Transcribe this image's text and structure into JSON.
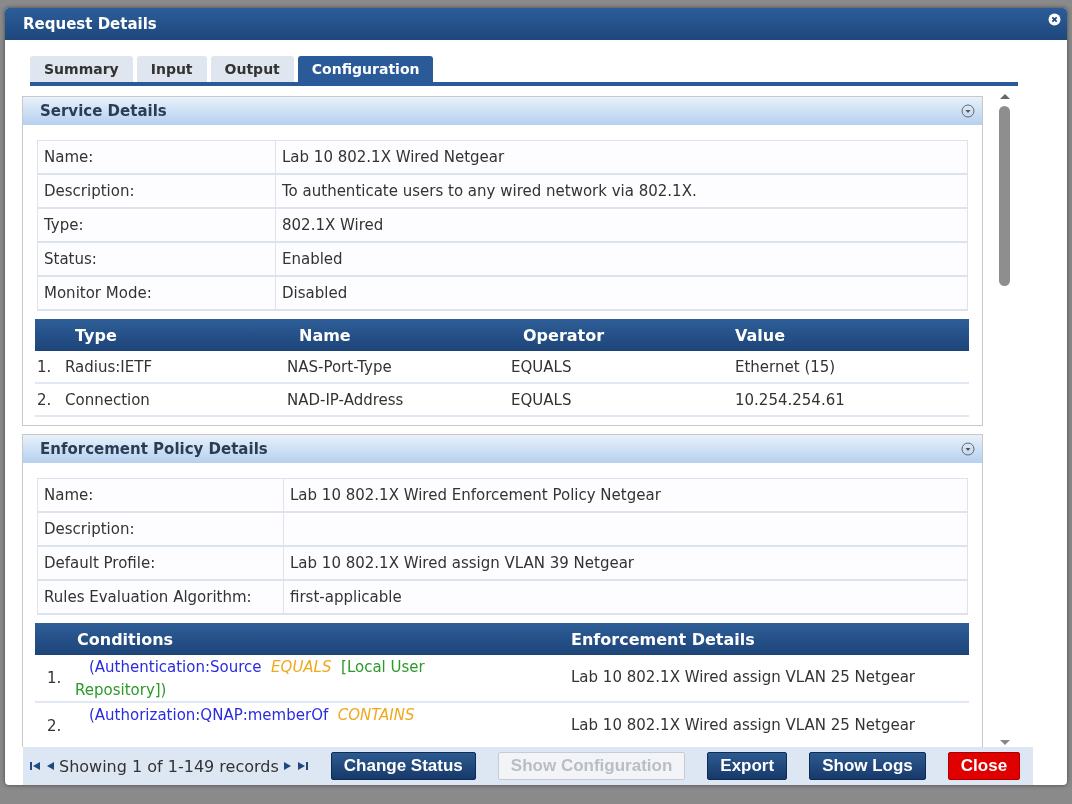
{
  "dialog": {
    "title": "Request Details"
  },
  "tabs": [
    {
      "label": "Summary",
      "selected": false
    },
    {
      "label": "Input",
      "selected": false
    },
    {
      "label": "Output",
      "selected": false
    },
    {
      "label": "Configuration",
      "selected": true
    }
  ],
  "service_details": {
    "title": "Service Details",
    "fields": [
      {
        "label": "Name:",
        "value": "Lab 10 802.1X Wired Netgear"
      },
      {
        "label": "Description:",
        "value": "To authenticate users to any wired network via 802.1X."
      },
      {
        "label": "Type:",
        "value": "802.1X Wired"
      },
      {
        "label": "Status:",
        "value": "Enabled"
      },
      {
        "label": "Monitor Mode:",
        "value": "Disabled"
      }
    ],
    "table": {
      "columns": [
        "Type",
        "Name",
        "Operator",
        "Value"
      ],
      "rows": [
        {
          "index": "1.",
          "cells": [
            "Radius:IETF",
            "NAS-Port-Type",
            "EQUALS",
            "Ethernet (15)"
          ]
        },
        {
          "index": "2.",
          "cells": [
            "Connection",
            "NAD-IP-Address",
            "EQUALS",
            "10.254.254.61"
          ]
        }
      ]
    }
  },
  "enforcement_policy_details": {
    "title": "Enforcement Policy Details",
    "fields": [
      {
        "label": "Name:",
        "value": "Lab 10 802.1X Wired Enforcement Policy Netgear"
      },
      {
        "label": "Description:"
      },
      {
        "label": "Default Profile:",
        "value": "Lab 10 802.1X Wired assign VLAN 39 Netgear"
      },
      {
        "label": "Rules Evaluation Algorithm:",
        "value": "first-applicable"
      }
    ],
    "table": {
      "columns": [
        "Conditions",
        "Enforcement Details"
      ],
      "rows": [
        {
          "index": "1.",
          "condition": [
            {
              "kind": "attribute",
              "text": "(Authentication:Source"
            },
            {
              "kind": "operator",
              "text": "EQUALS"
            },
            {
              "kind": "value",
              "text": "[Local User Repository])"
            }
          ],
          "details": "Lab 10 802.1X Wired assign VLAN 25 Netgear"
        },
        {
          "index": "2.",
          "condition": [
            {
              "kind": "attribute",
              "text": "(Authorization:QNAP:memberOf"
            },
            {
              "kind": "operator",
              "text": "CONTAINS"
            }
          ],
          "details": "Lab 10 802.1X Wired assign VLAN 25 Netgear"
        }
      ]
    }
  },
  "footer": {
    "pager_text": "Showing 1 of 1-149 records",
    "buttons": [
      {
        "label": "Change Status",
        "kind": "primary",
        "disabled": false
      },
      {
        "label": "Show Configuration",
        "kind": "primary",
        "disabled": true
      },
      {
        "label": "Export",
        "kind": "primary",
        "disabled": false
      },
      {
        "label": "Show Logs",
        "kind": "primary",
        "disabled": false
      },
      {
        "label": "Close",
        "kind": "danger",
        "disabled": false
      }
    ]
  }
}
